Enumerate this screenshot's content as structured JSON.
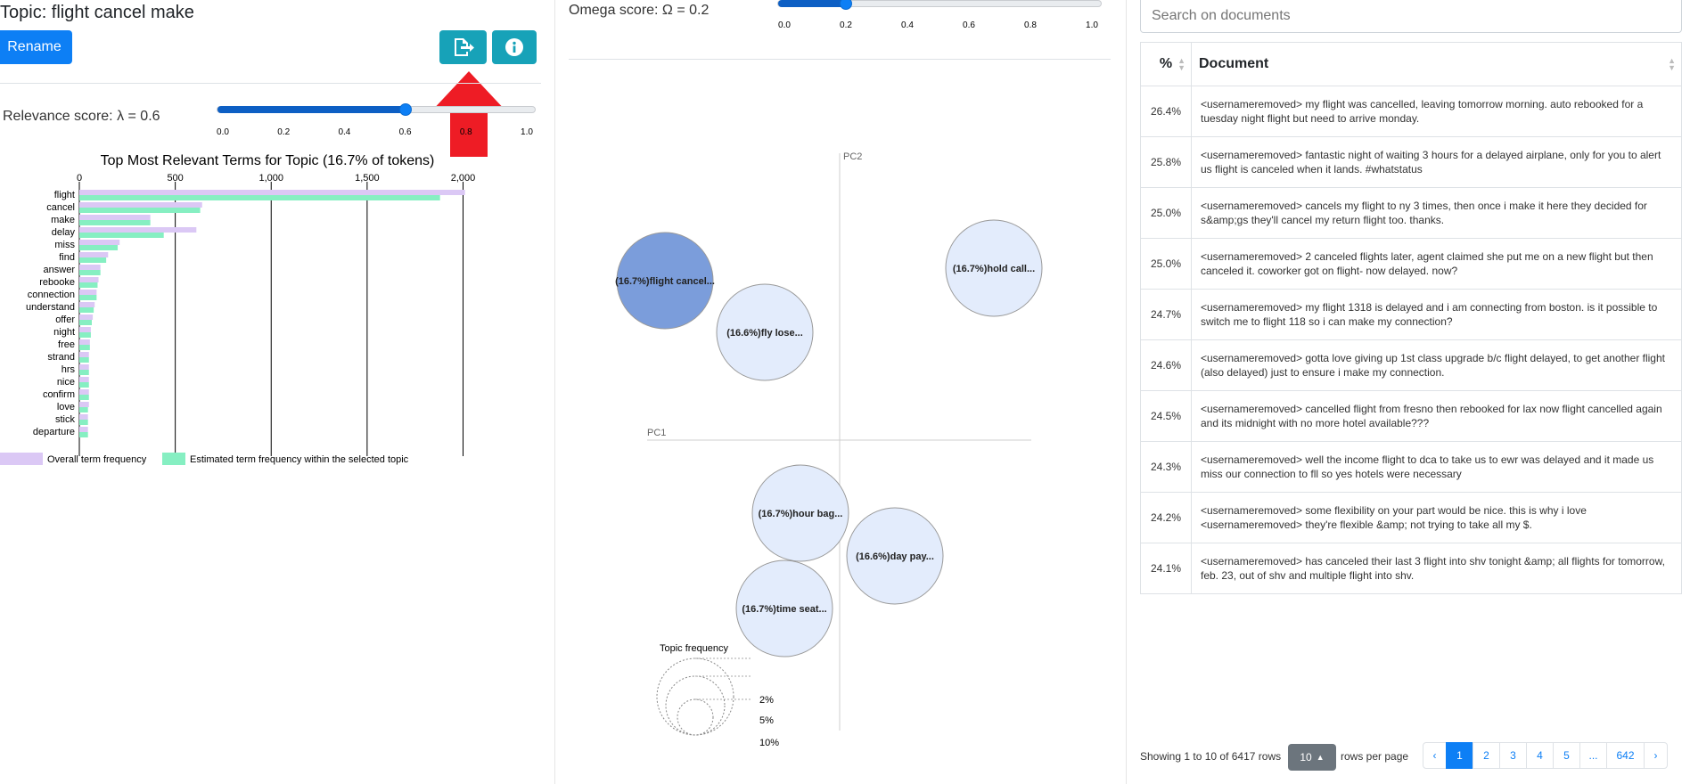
{
  "topic_panel": {
    "title": "Topic: flight cancel make",
    "rename_label": "Rename",
    "export_icon": "file-export-icon",
    "info_icon": "info-circle-icon",
    "relevance_label": "Relevance score: λ = 0.6",
    "relevance_value": 0.6,
    "relevance_ticks": [
      "0.0",
      "0.2",
      "0.4",
      "0.6",
      "0.8",
      "1.0"
    ]
  },
  "omega": {
    "label": "Omega score: Ω = 0.2",
    "value": 0.2,
    "ticks": [
      "0.0",
      "0.2",
      "0.4",
      "0.6",
      "0.8",
      "1.0"
    ]
  },
  "chart_data": {
    "type": "bar",
    "title": "Top Most Relevant Terms for Topic (16.7% of tokens)",
    "categories": [
      "flight",
      "cancel",
      "make",
      "delay",
      "miss",
      "find",
      "answer",
      "rebooke",
      "connection",
      "understand",
      "offer",
      "night",
      "free",
      "strand",
      "hrs",
      "nice",
      "confirm",
      "love",
      "stick",
      "departure"
    ],
    "series": [
      {
        "name": "Overall term frequency",
        "color": "#dbc8f5",
        "values": [
          2010,
          640,
          370,
          610,
          210,
          150,
          110,
          100,
          90,
          80,
          70,
          60,
          55,
          50,
          50,
          50,
          50,
          50,
          45,
          45
        ]
      },
      {
        "name": "Estimated term frequency within the selected topic",
        "color": "#86efc2",
        "values": [
          1880,
          630,
          370,
          440,
          200,
          140,
          110,
          95,
          90,
          75,
          65,
          60,
          55,
          50,
          50,
          50,
          50,
          45,
          45,
          45
        ]
      }
    ],
    "xticks": [
      "0",
      "500",
      "1,000",
      "1,500",
      "2,000"
    ],
    "xlim": [
      0,
      2100
    ]
  },
  "pca": {
    "pc1_label": "PC1",
    "pc2_label": "PC2",
    "topics": [
      "(16.7%)flight cancel...",
      "(16.6%)fly lose...",
      "(16.7%)hold call...",
      "(16.7%)hour bag...",
      "(16.6%)day pay...",
      "(16.7%)time seat..."
    ],
    "freq_title": "Topic frequency",
    "freq_labels": [
      "2%",
      "5%",
      "10%"
    ]
  },
  "documents": {
    "search_placeholder": "Search on documents",
    "col_pct": "%",
    "col_doc": "Document",
    "rows": [
      {
        "pct": "26.4%",
        "text": "<usernameremoved> my flight was cancelled, leaving tomorrow morning. auto rebooked for a tuesday night flight but need to arrive monday."
      },
      {
        "pct": "25.8%",
        "text": "<usernameremoved> fantastic night of waiting 3 hours for a delayed airplane, only for you to alert us flight is canceled when it lands. #whatstatus"
      },
      {
        "pct": "25.0%",
        "text": "<usernameremoved> cancels my flight to ny 3 times, then once i make it here they decided for s&amp;gs they'll cancel my return flight too. thanks."
      },
      {
        "pct": "25.0%",
        "text": "<usernameremoved> 2 canceled flights later, agent claimed she put me on a new flight but then canceled it. coworker got on flight- now delayed. now?"
      },
      {
        "pct": "24.7%",
        "text": "<usernameremoved> my flight 1318 is delayed and i am connecting from boston. is it possible to switch me to flight 118 so i can make my connection?"
      },
      {
        "pct": "24.6%",
        "text": "<usernameremoved> gotta love giving up 1st class upgrade b/c flight delayed, to get another flight (also delayed) just to ensure i make my connection."
      },
      {
        "pct": "24.5%",
        "text": "<usernameremoved> cancelled flight from fresno then rebooked for lax now flight cancelled again and its midnight with no more hotel available???"
      },
      {
        "pct": "24.3%",
        "text": "<usernameremoved> well the income flight to dca to take us to ewr was delayed and it made us miss our connection to fll so yes hotels were necessary"
      },
      {
        "pct": "24.2%",
        "text": "<usernameremoved> some flexibility on your part would be nice. this is why i love <usernameremoved> they're flexible &amp; not trying to take all my $."
      },
      {
        "pct": "24.1%",
        "text": "<usernameremoved> has canceled their last 3 flight into shv tonight &amp; all flights for tomorrow, feb. 23, out of shv and multiple flight into shv."
      }
    ],
    "footer_showing": "Showing 1 to 10 of 6417 rows",
    "page_size": "10",
    "rows_per_page": "rows per page",
    "pages": [
      "‹",
      "1",
      "2",
      "3",
      "4",
      "5",
      "...",
      "642",
      "›"
    ]
  },
  "colors": {
    "accent": "#0d7ff5",
    "teal": "#17a2b8",
    "arrow": "#ee1c25",
    "selected_topic": "#7b9ddb",
    "topic": "#e3ecfc"
  }
}
